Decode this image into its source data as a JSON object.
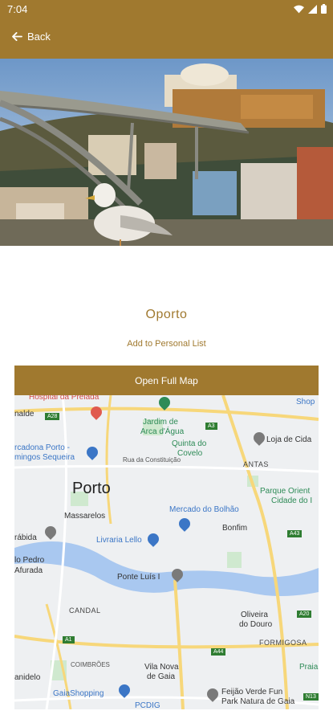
{
  "status": {
    "time": "7:04"
  },
  "appbar": {
    "back_label": "Back"
  },
  "place": {
    "title": "Oporto",
    "add_label": "Add to Personal List",
    "map_button": "Open Full Map"
  },
  "map": {
    "labels": {
      "hospital": "Hospital da Prelada",
      "shop": "Shop",
      "nalde": "nalde",
      "jardim1": "Jardim de",
      "jardim2": "Arca d'Água",
      "quinta1": "Quinta do",
      "quinta2": "Covelo",
      "loja": "Loja de Cida",
      "mercadona1": "rcadona Porto -",
      "mercadona2": "mingos Sequeira",
      "rua": "Rua da Constituição",
      "antas": "ANTAS",
      "porto": "Porto",
      "parque1": "Parque Orient",
      "parque2": "Cidade do I",
      "massarelos": "Massarelos",
      "mercado": "Mercado do Bolhão",
      "bonfim": "Bonfim",
      "rabida": "rábida",
      "lello": "Livraria Lello",
      "pedro1": "lo Pedro",
      "pedro2": "Afurada",
      "ponte": "Ponte Luís I",
      "candal": "CANDAL",
      "oliveira1": "Oliveira",
      "oliveira2": "do Douro",
      "formigosa": "FORMIGOSA",
      "praia": "Praia",
      "anidelo": "anidelo",
      "coimbroes": "COIMBRÕES",
      "vila1": "Vila Nova",
      "vila2": "de Gaia",
      "gaiashopping": "GaiaShopping",
      "pcdig": "PCDIG",
      "feijao1": "Feijão Verde Fun",
      "feijao2": "Park Natura de Gaia"
    },
    "roads": [
      "A28",
      "A3",
      "A1",
      "A43",
      "A20",
      "A44",
      "N13"
    ]
  }
}
